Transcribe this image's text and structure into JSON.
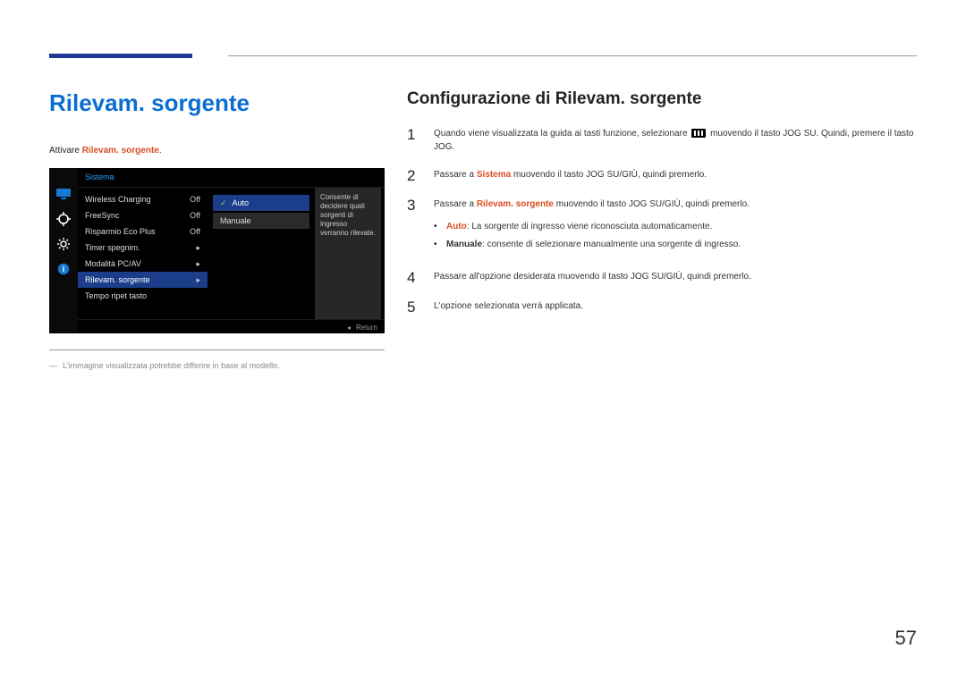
{
  "page_number": "57",
  "left": {
    "title": "Rilevam. sorgente",
    "attivare_prefix": "Attivare ",
    "attivare_highlight": "Rilevam. sorgente",
    "attivare_suffix": ".",
    "footnote": "L'immagine visualizzata potrebbe differire in base al modello."
  },
  "osd": {
    "header": "Sistema",
    "desc": "Consente di decidere quali sorgenti di ingresso verranno rilevate.",
    "footer_return": "Return",
    "rows": [
      {
        "label": "Wireless Charging",
        "value": "Off",
        "arrow": false
      },
      {
        "label": "FreeSync",
        "value": "Off",
        "arrow": false
      },
      {
        "label": "Risparmio Eco Plus",
        "value": "Off",
        "arrow": false
      },
      {
        "label": "Timer spegnim.",
        "value": "",
        "arrow": true
      },
      {
        "label": "Modalità PC/AV",
        "value": "",
        "arrow": true
      },
      {
        "label": "Rilevam. sorgente",
        "value": "",
        "arrow": true,
        "selected": true
      },
      {
        "label": "Tempo ripet tasto",
        "value": "",
        "arrow": false
      }
    ],
    "submenu": [
      {
        "label": "Auto",
        "selected": true
      },
      {
        "label": "Manuale",
        "selected": false
      }
    ]
  },
  "right": {
    "title": "Configurazione di Rilevam. sorgente",
    "steps": {
      "s1_a": "Quando viene visualizzata la guida ai tasti funzione, selezionare ",
      "s1_b": " muovendo il tasto JOG SU. Quindi, premere il tasto JOG.",
      "s2_a": "Passare a ",
      "s2_hl": "Sistema",
      "s2_b": " muovendo il tasto JOG SU/GIÙ, quindi premerlo.",
      "s3_a": "Passare a ",
      "s3_hl": "Rilevam. sorgente",
      "s3_b": " muovendo il tasto JOG SU/GIÙ, quindi premerlo.",
      "bullet_auto_hl": "Auto",
      "bullet_auto_txt": ": La sorgente di ingresso viene riconosciuta automaticamente.",
      "bullet_man_hl": "Manuale",
      "bullet_man_txt": ": consente di selezionare manualmente una sorgente di ingresso.",
      "s4": "Passare all'opzione desiderata muovendo il tasto JOG SU/GIÙ, quindi premerlo.",
      "s5": "L'opzione selezionata verrà applicata."
    }
  }
}
